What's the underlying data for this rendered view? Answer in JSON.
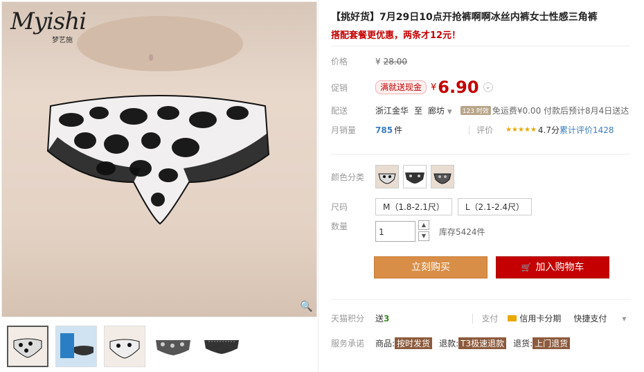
{
  "product": {
    "title": "【挑好货】7月29日10点开抢裤啊啊冰丝内裤女士性感三角裤",
    "subtitle": "搭配套餐更优惠，两条才12元！"
  },
  "brand": {
    "logo": "Myishi",
    "logo_sub": "梦艺施"
  },
  "price": {
    "label": "价格",
    "currency": "¥",
    "original": "28.00"
  },
  "promo": {
    "label": "促销",
    "tag": "满就送现金",
    "currency": "¥",
    "price": "6.90",
    "dropdown": "⌄"
  },
  "delivery": {
    "label": "配送",
    "from": "浙江金华",
    "to_word": "至",
    "dest": "廊坊",
    "time_tag": "123 时效",
    "fee": "免运费¥0.00 付款后预计8月4日送达"
  },
  "sales": {
    "label": "月销量",
    "count": "785",
    "unit": "件",
    "review_label": "评价",
    "stars": "★★★★★",
    "rating": "4.7分",
    "review_text": "累计评价1428"
  },
  "color": {
    "label": "颜色分类"
  },
  "size": {
    "label": "尺码",
    "options": [
      "M（1.8-2.1尺）",
      "L（2.1-2.4尺）"
    ]
  },
  "quantity": {
    "label": "数量",
    "value": "1",
    "up": "▲",
    "down": "▼",
    "stock": "库存5424件"
  },
  "buttons": {
    "buy": "立刻购买",
    "cart": "加入购物车",
    "cart_icon": "🛒"
  },
  "points": {
    "label": "天猫积分",
    "send": "送",
    "value": "3",
    "pay_label": "支付",
    "credit": "信用卡分期",
    "quick": "快捷支付",
    "arrow": "▾"
  },
  "service": {
    "label": "服务承诺",
    "goods_label": "商品:",
    "goods_tag": "按时发货",
    "refund_label": "退款:",
    "refund_tag": "T3极速退款",
    "return_label": "退货:",
    "return_tag": "上门退货"
  },
  "zoom_icon": "🔍",
  "colors": {
    "accent": "#c40000",
    "buy": "#d98e47",
    "tag": "#8c5a3c"
  }
}
